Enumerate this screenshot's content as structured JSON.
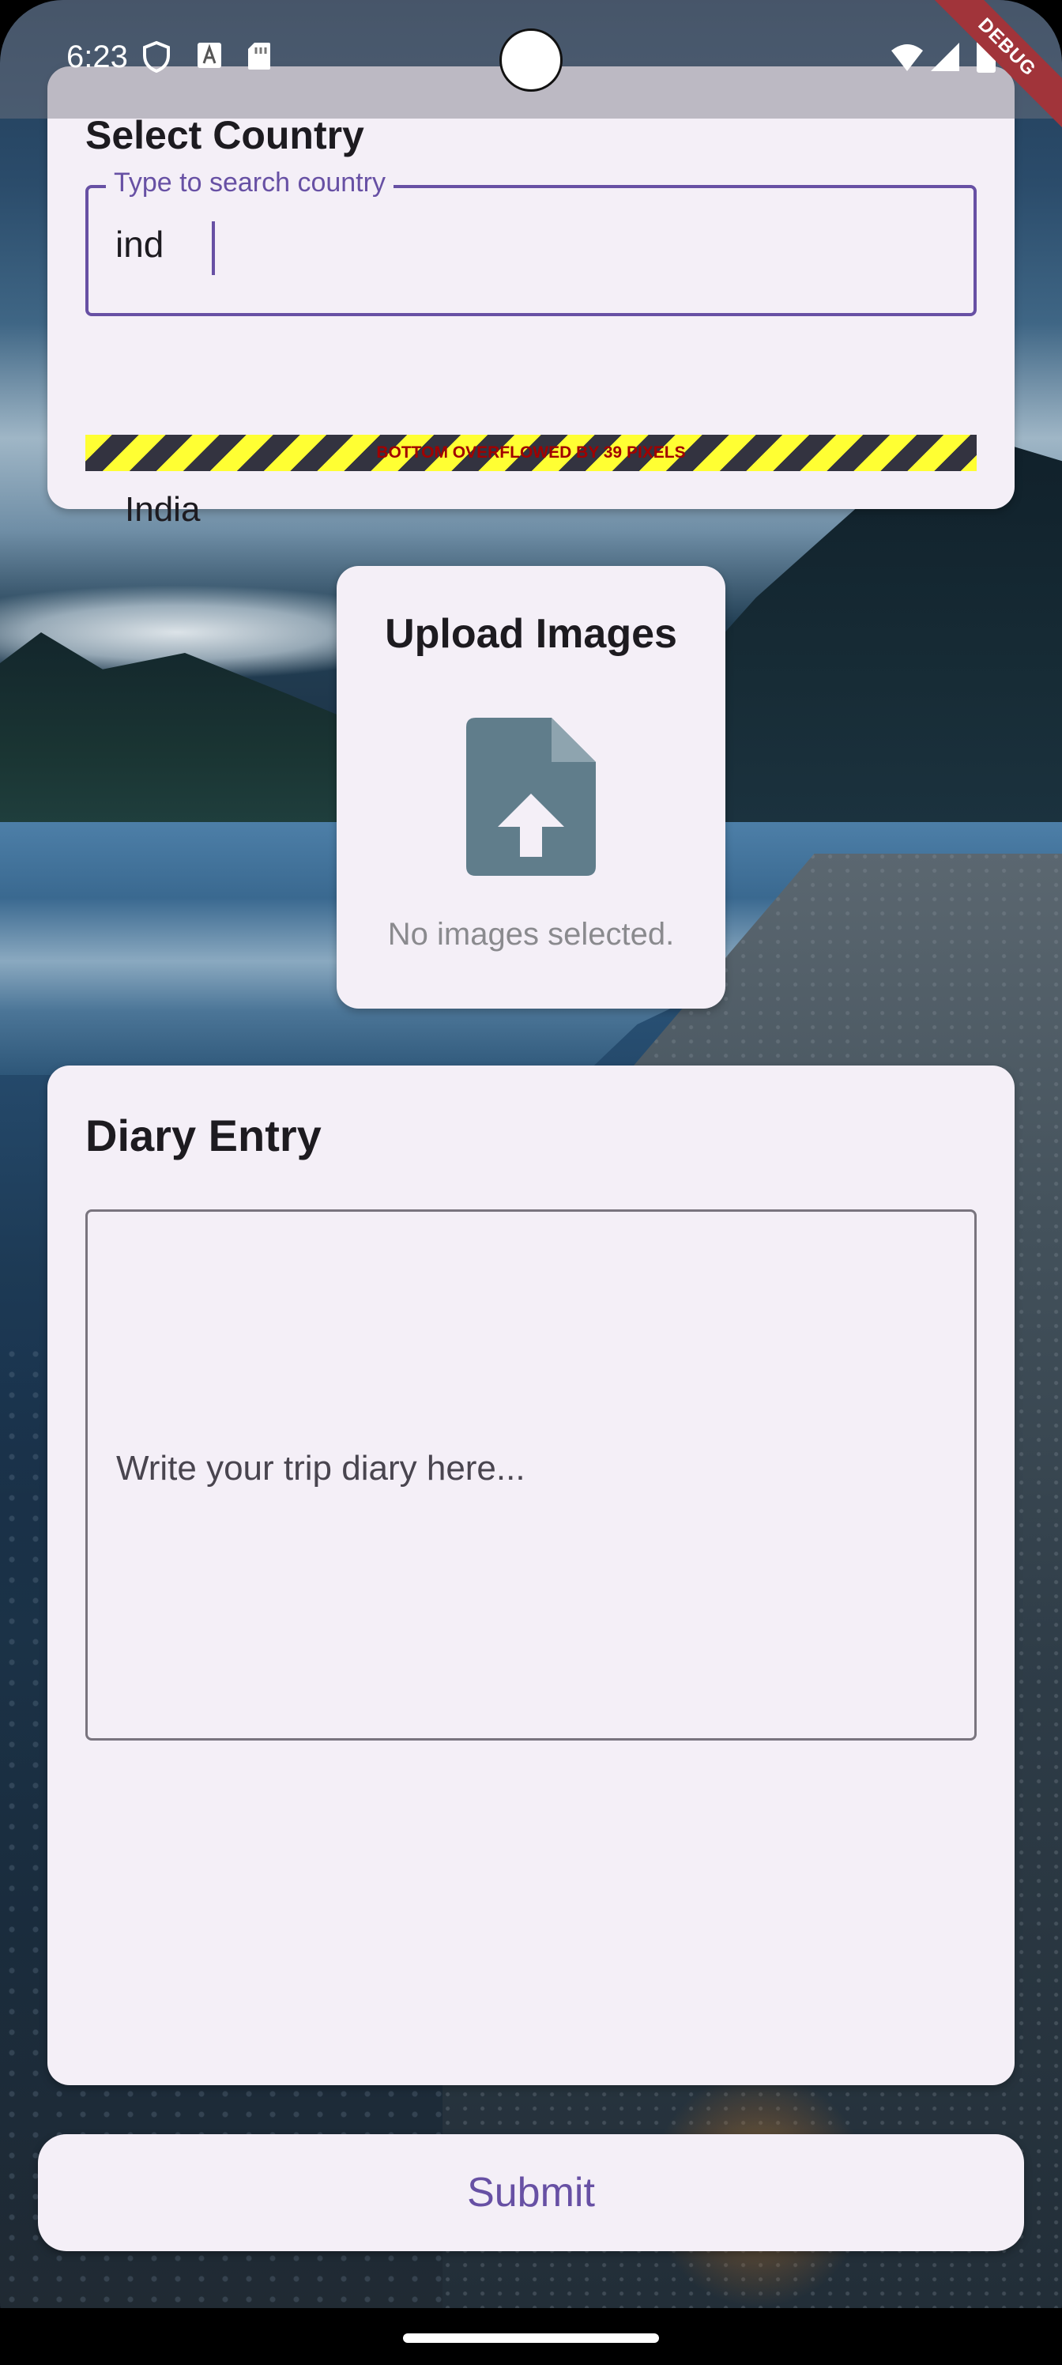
{
  "status_bar": {
    "time": "6:23"
  },
  "debug_banner": "DEBUG",
  "country_card": {
    "title": "Select Country",
    "search_label": "Type to search country",
    "search_value": "ind",
    "overflow_warning": "BOTTOM OVERFLOWED BY 39 PIXELS",
    "suggestion": "India"
  },
  "upload_card": {
    "title": "Upload Images",
    "icon": "file-upload-icon",
    "status": "No images selected."
  },
  "diary_card": {
    "title": "Diary Entry",
    "placeholder": "Write your trip diary here..."
  },
  "submit": {
    "label": "Submit"
  },
  "colors": {
    "accent": "#6750a4",
    "card_bg": "#f4eff7",
    "icon": "#607d8b"
  }
}
